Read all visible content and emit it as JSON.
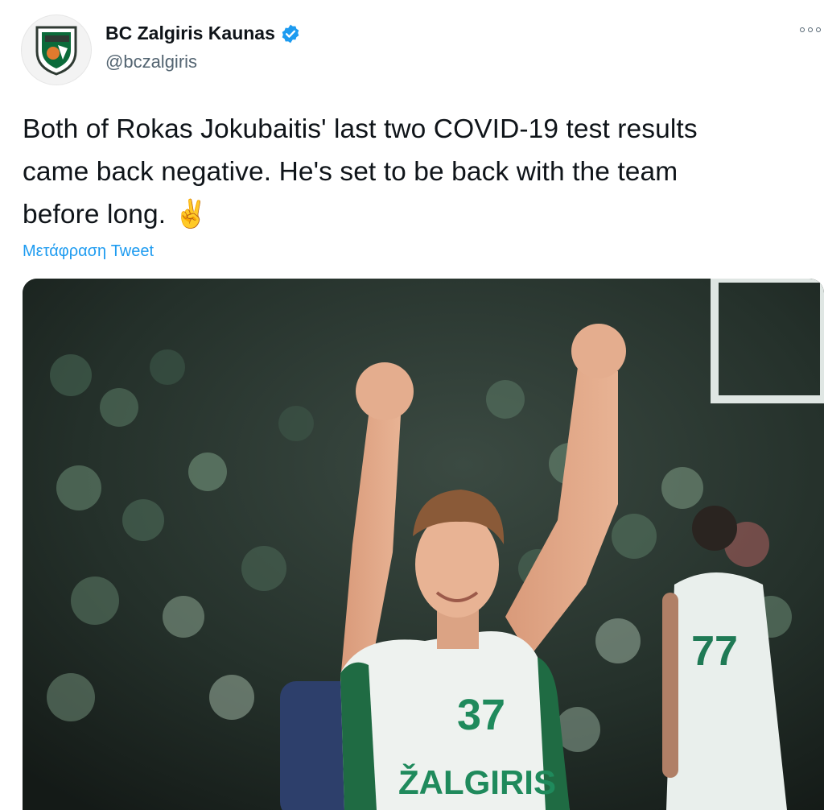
{
  "author": {
    "name": "BC Zalgiris Kaunas",
    "handle": "@bczalgiris",
    "verified": true,
    "avatar_icon": "zalgiris-crest-icon"
  },
  "tweet": {
    "text_line1": "Both of Rokas Jokubaitis' last two COVID-19 test results",
    "text_line2": "came back negative. He's set to be back with the team",
    "text_line3": "before long.",
    "emoji": "✌️",
    "translate_label": "Μετάφραση Tweet"
  },
  "media": {
    "jersey_main_number": "37",
    "jersey_main_text": "ŽALGIRIS",
    "jersey_right_number": "77"
  },
  "colors": {
    "accent": "#1d9bf0",
    "text": "#0f1419",
    "secondary": "#536471",
    "zalgiris_green": "#0b6b3a"
  }
}
